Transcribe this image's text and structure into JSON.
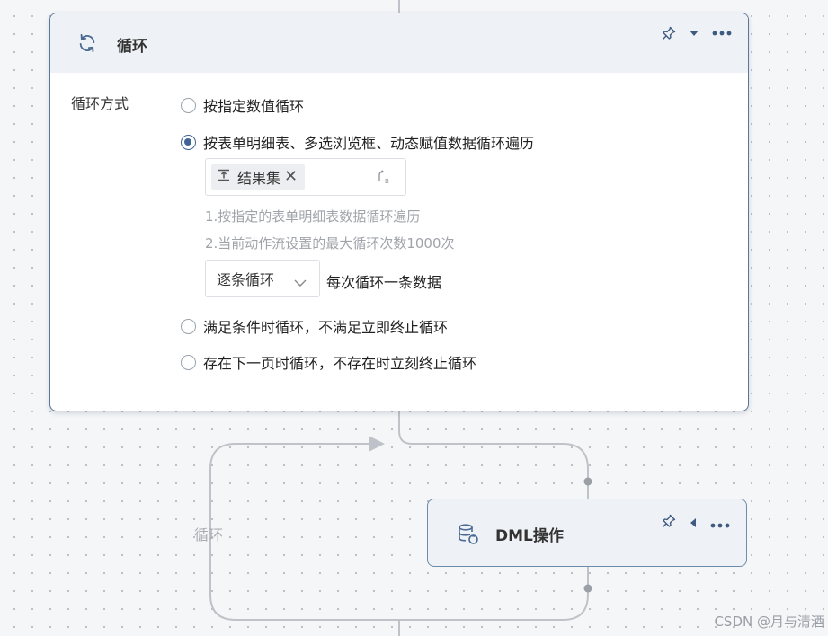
{
  "loop_node": {
    "title": "循环",
    "form_label": "循环方式",
    "options": [
      {
        "label": "按指定数值循环",
        "checked": false
      },
      {
        "label": "按表单明细表、多选浏览框、动态赋值数据循环遍历",
        "checked": true
      },
      {
        "label": "满足条件时循环，不满足立即终止循环",
        "checked": false
      },
      {
        "label": "存在下一页时循环，不存在时立刻终止循环",
        "checked": false
      }
    ],
    "dataset_tag": "结果集",
    "hints": [
      "1.按指定的表单明细表数据循环遍历",
      "2.当前动作流设置的最大循环次数1000次"
    ],
    "mode_select": "逐条循环",
    "mode_note": "每次循环一条数据"
  },
  "edge_label": "循环",
  "dml_node": {
    "title": "DML操作"
  },
  "watermark": "CSDN @月与清酒",
  "colors": {
    "accent": "#3f6595",
    "card_border": "#5a7699",
    "header_bg": "#eef1f5"
  }
}
